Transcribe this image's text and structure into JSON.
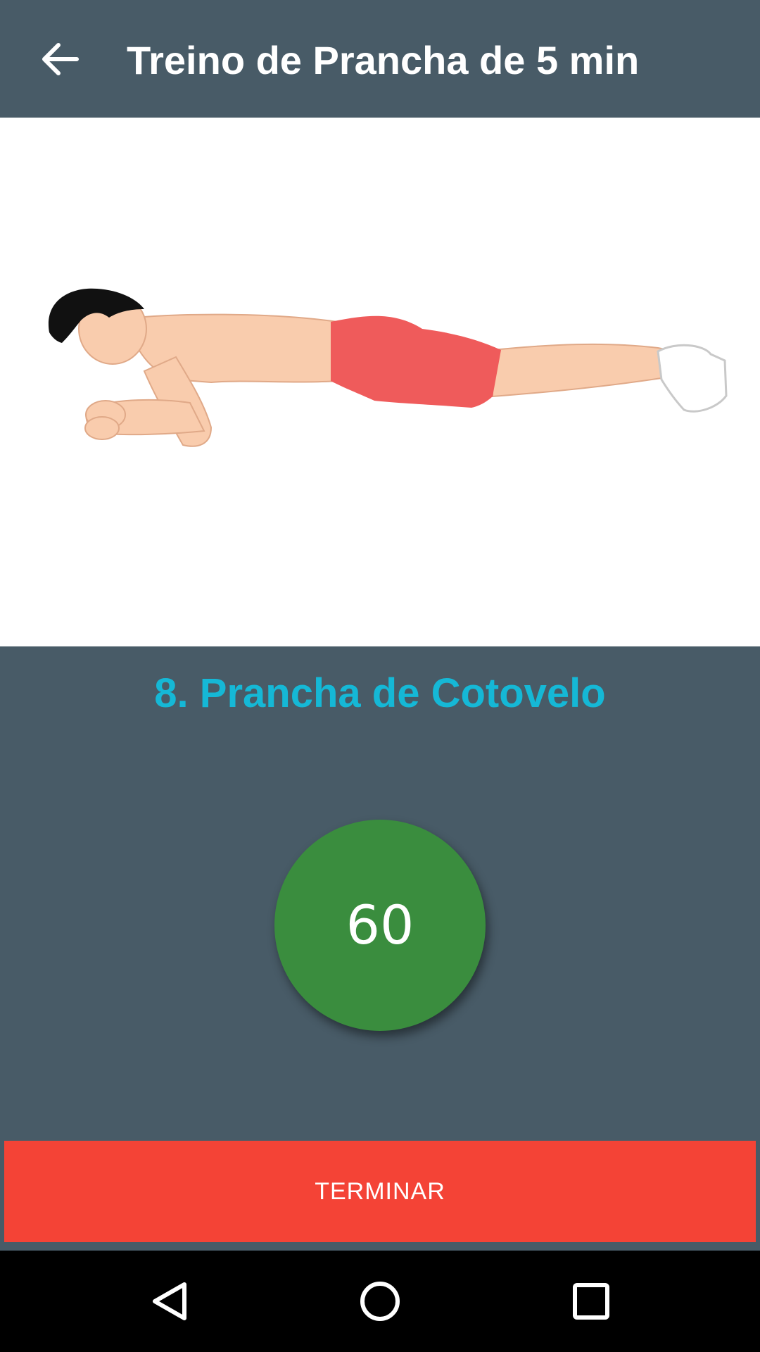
{
  "app_bar": {
    "title": "Treino de Prancha de 5 min",
    "back_icon": "arrow-back-icon"
  },
  "exercise": {
    "title": "8. Prancha de Cotovelo",
    "illustration": "elbow-plank-illustration"
  },
  "timer": {
    "value": "60",
    "color": "#3a8d3e"
  },
  "actions": {
    "finish_label": "TERMINAR",
    "finish_color": "#f44336"
  },
  "nav_bar": {
    "back_icon": "nav-back-icon",
    "home_icon": "nav-home-icon",
    "recents_icon": "nav-recents-icon"
  },
  "colors": {
    "header_bg": "#485b67",
    "accent": "#15b8d6"
  }
}
